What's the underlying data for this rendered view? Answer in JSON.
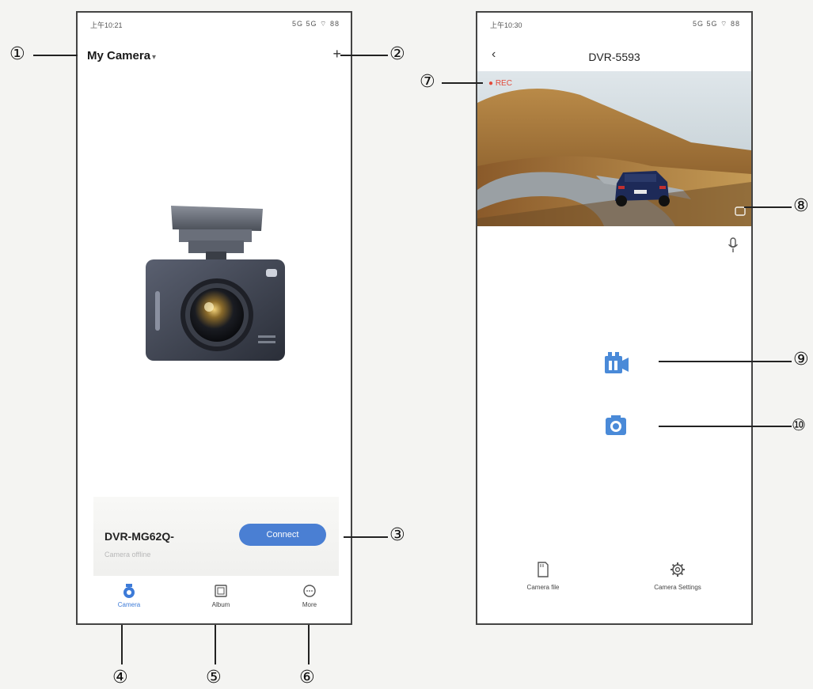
{
  "phone1": {
    "status_time": "上午10:21",
    "status_icons": "5G 5G ⌔ 88",
    "title": "My Camera",
    "title_caret": "▾",
    "add_label": "+",
    "device": {
      "name": "DVR-MG62Q-",
      "status": "Camera offline",
      "connect_label": "Connect"
    },
    "tabs": [
      {
        "label": "Camera",
        "icon": "camera-icon"
      },
      {
        "label": "Album",
        "icon": "album-icon"
      },
      {
        "label": "More",
        "icon": "more-icon"
      }
    ]
  },
  "phone2": {
    "status_time": "上午10:30",
    "status_icons": "5G 5G ⌔ 88",
    "back_label": "‹",
    "title": "DVR-5593",
    "rec_label": "REC",
    "actions": [
      {
        "label": "Camera file",
        "icon": "sd-card-icon"
      },
      {
        "label": "Camera Settings",
        "icon": "gear-icon"
      }
    ]
  },
  "callouts": {
    "c1": "①",
    "c2": "②",
    "c3": "③",
    "c4": "④",
    "c5": "⑤",
    "c6": "⑥",
    "c7": "⑦",
    "c8": "⑧",
    "c9": "⑨",
    "c10": "⑩"
  },
  "colors": {
    "accent": "#4a7fd3",
    "rec": "#e24a3b"
  }
}
